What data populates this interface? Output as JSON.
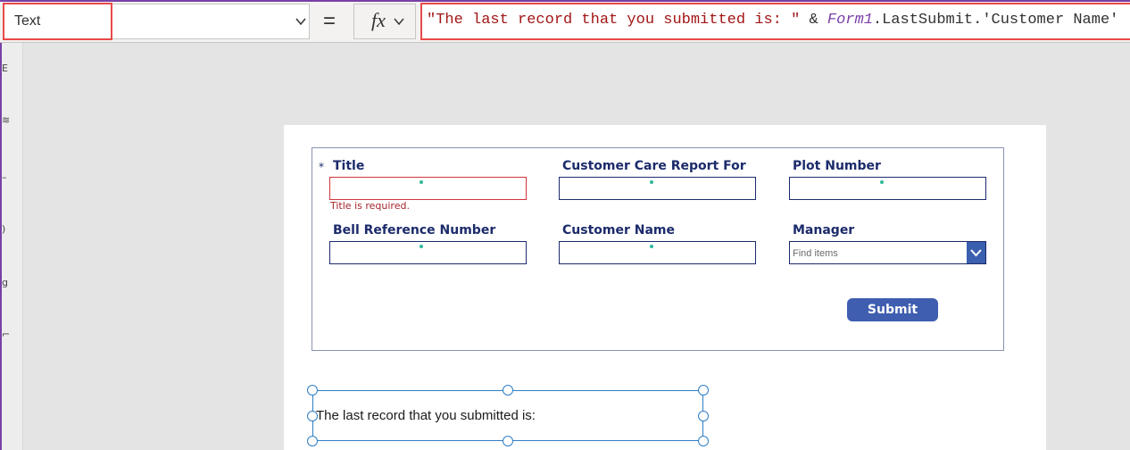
{
  "formula_bar": {
    "property": "Text",
    "equals": "=",
    "fx_label": "fx",
    "formula_tokens": {
      "string_literal": "\"The last record that you submitted is: \"",
      "operator": " & ",
      "control": "Form1",
      "property_path": ".LastSubmit.'Customer Name'"
    }
  },
  "left_strip": [
    "E",
    "≋",
    "–",
    ")",
    "g",
    "⌐"
  ],
  "form": {
    "required_star": "*",
    "fields": {
      "title": "Title",
      "customer_care_report_for": "Customer Care Report For",
      "plot_number": "Plot Number",
      "bell_reference_number": "Bell Reference Number",
      "customer_name": "Customer Name",
      "manager": "Manager"
    },
    "title_error": "Title is required.",
    "manager_placeholder": "Find items",
    "submit_label": "Submit"
  },
  "result_label": {
    "text": "The last record that you submitted is:"
  },
  "colors": {
    "accent_purple": "#7a3fa8",
    "highlight_red": "#e84a4a",
    "field_label_navy": "#1c2b6b",
    "button_blue": "#3f5eb0",
    "error_red": "#a4262c"
  }
}
